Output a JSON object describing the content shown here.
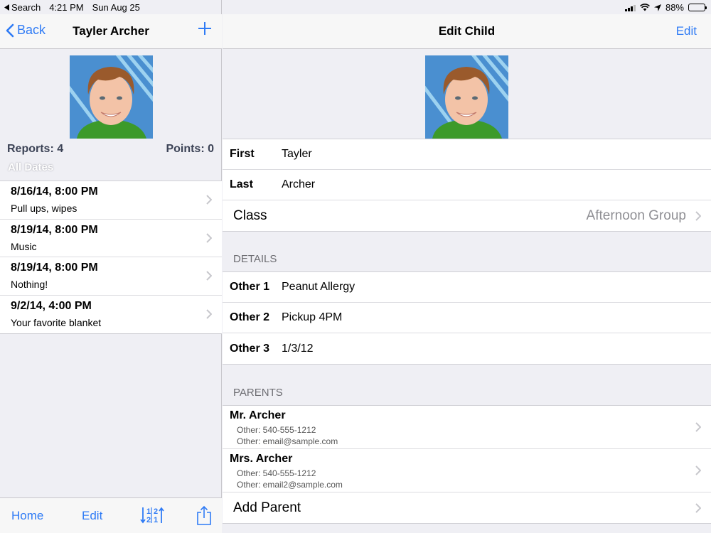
{
  "status": {
    "back_app": "Search",
    "time": "4:21 PM",
    "date": "Sun Aug 25",
    "battery": "88%",
    "battery_level": 0.88
  },
  "left": {
    "back_label": "Back",
    "title": "Tayler Archer",
    "reports": "Reports: 4",
    "points": "Points: 0",
    "date_filter": "All Dates",
    "reports_list": [
      {
        "date": "8/16/14, 8:00 PM",
        "note": "Pull ups, wipes"
      },
      {
        "date": "8/19/14, 8:00 PM",
        "note": "Music"
      },
      {
        "date": "8/19/14, 8:00 PM",
        "note": "Nothing!"
      },
      {
        "date": "9/2/14, 4:00 PM",
        "note": "Your favorite blanket"
      }
    ],
    "toolbar": {
      "home": "Home",
      "edit": "Edit"
    }
  },
  "right": {
    "title": "Edit Child",
    "edit": "Edit",
    "first_label": "First",
    "first_value": "Tayler",
    "last_label": "Last",
    "last_value": "Archer",
    "class_label": "Class",
    "class_value": "Afternoon Group",
    "details_header": "DETAILS",
    "details": [
      {
        "label": "Other 1",
        "value": "Peanut Allergy"
      },
      {
        "label": "Other 2",
        "value": "Pickup 4PM"
      },
      {
        "label": "Other 3",
        "value": "1/3/12"
      }
    ],
    "parents_header": "PARENTS",
    "parents": [
      {
        "name": "Mr. Archer",
        "line1": "Other: 540-555-1212",
        "line2": "Other: email@sample.com"
      },
      {
        "name": "Mrs. Archer",
        "line1": "Other: 540-555-1212",
        "line2": "Other: email2@sample.com"
      }
    ],
    "add_parent": "Add Parent"
  },
  "colors": {
    "accent": "#2f7bf5",
    "background": "#efeff4"
  }
}
